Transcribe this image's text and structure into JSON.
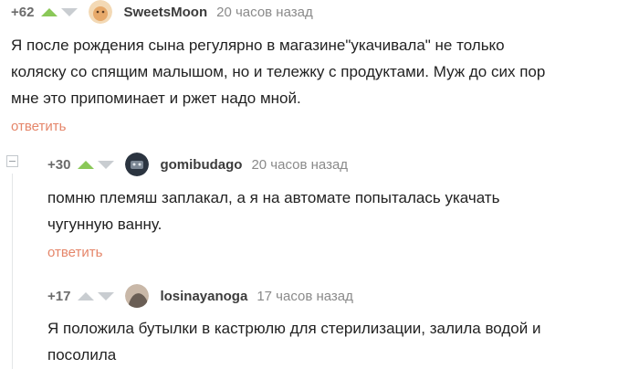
{
  "comments": [
    {
      "rating": "+62",
      "username": "SweetsMoon",
      "time": "20 часов назад",
      "text_lines": [
        "Я после рождения сына регулярно в магазине\"укачивала\" не только",
        "коляску со спящим малышом, но и тележку с продуктами. Муж до сих пор",
        "мне это припоминает и ржет надо мной."
      ],
      "reply_label": "ответить",
      "avatar_colors": [
        "#f3d9b5",
        "#e7a96a"
      ]
    },
    {
      "rating": "+30",
      "username": "gomibudago",
      "time": "20 часов назад",
      "text_lines": [
        "помню племяш заплакал, а я на автомате попыталась укачать",
        "чугунную ванну."
      ],
      "reply_label": "ответить",
      "avatar_colors": [
        "#2b3440",
        "#7c8794"
      ]
    },
    {
      "rating": "+17",
      "username": "losinayanoga",
      "time": "17 часов назад",
      "text_lines": [
        "Я положила бутылки в кастрюлю для стерилизации, залила водой и",
        "посолила"
      ],
      "avatar_colors": [
        "#6a5e55",
        "#c9b8a8"
      ]
    }
  ]
}
